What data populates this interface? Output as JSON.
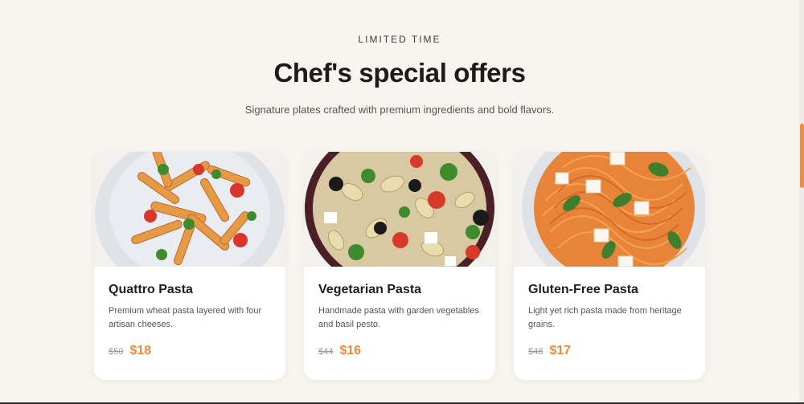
{
  "header": {
    "eyebrow": "LIMITED TIME",
    "title": "Chef's special offers",
    "subtitle": "Signature plates crafted with premium ingredients and bold flavors."
  },
  "cards": [
    {
      "name": "Quattro Pasta",
      "description": "Premium wheat pasta layered with four artisan cheeses.",
      "old_price": "$50",
      "new_price": "$18",
      "image_icon": "penne-pasta-dish-image"
    },
    {
      "name": "Vegetarian Pasta",
      "description": "Handmade pasta with garden vegetables and basil pesto.",
      "old_price": "$44",
      "new_price": "$16",
      "image_icon": "vegetable-fusilli-dish-image"
    },
    {
      "name": "Gluten-Free Pasta",
      "description": "Light yet rich pasta made from heritage grains.",
      "old_price": "$48",
      "new_price": "$17",
      "image_icon": "spaghetti-dish-image"
    }
  ],
  "colors": {
    "background": "#f8f5f0",
    "accent": "#ef8a3b",
    "text_dark": "#1c1c1c"
  }
}
